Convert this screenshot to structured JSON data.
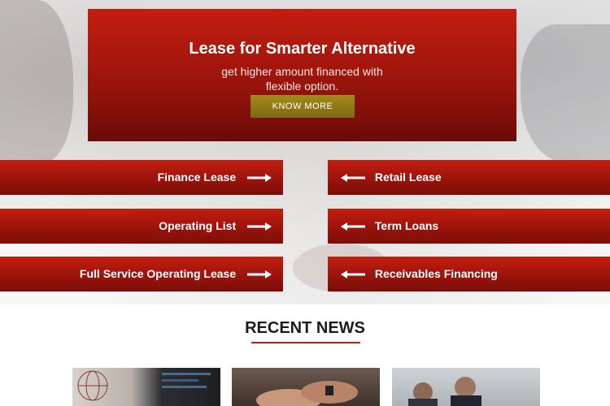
{
  "promo": {
    "title": "Lease for Smarter Alternative",
    "subtitle_line1": "get higher amount financed with",
    "subtitle_line2": "flexible option.",
    "button_label": "KNOW MORE"
  },
  "services": {
    "left": [
      {
        "label": "Finance Lease"
      },
      {
        "label": "Operating List"
      },
      {
        "label": "Full Service Operating Lease"
      }
    ],
    "right": [
      {
        "label": "Retail Lease"
      },
      {
        "label": "Term Loans"
      },
      {
        "label": "Receivables Financing"
      }
    ]
  },
  "news": {
    "heading": "RECENT NEWS"
  },
  "colors": {
    "brand_red": "#c41e0f",
    "button_gold": "#a48a1b"
  },
  "icons": {
    "right_arrow": "right-arrow-icon",
    "left_arrow": "left-arrow-icon"
  }
}
